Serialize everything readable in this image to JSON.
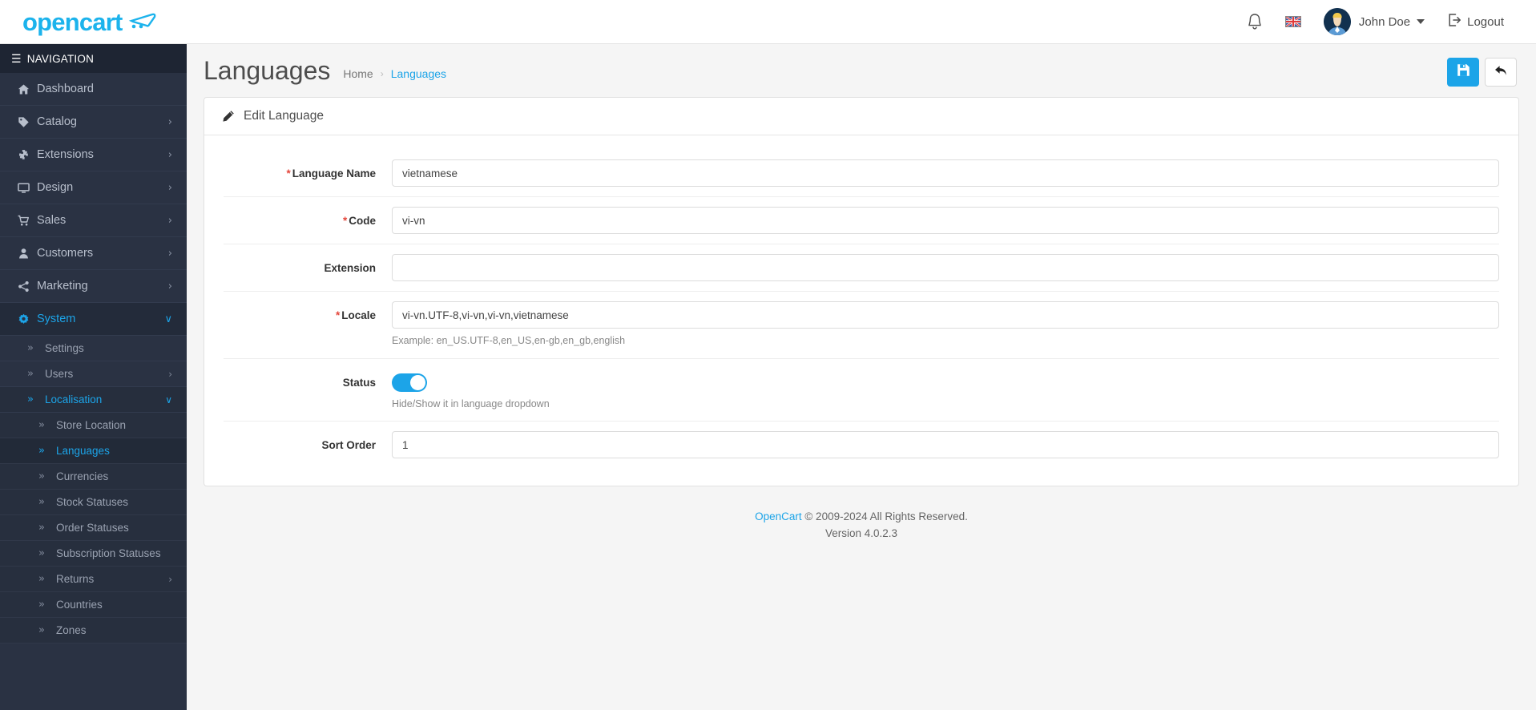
{
  "header": {
    "logo_text": "opencart",
    "bell_icon": "bell-icon",
    "flag_icon": "uk-flag-icon",
    "avatar_icon": "user-avatar",
    "user_name": "John Doe",
    "logout_label": "Logout",
    "logout_icon": "logout-icon"
  },
  "sidebar": {
    "nav_title": "NAVIGATION",
    "hamburger_icon": "hamburger-icon",
    "items": [
      {
        "label": "Dashboard",
        "icon": "home-icon",
        "arrow": "",
        "active": false
      },
      {
        "label": "Catalog",
        "icon": "tag-icon",
        "arrow": "›",
        "active": false
      },
      {
        "label": "Extensions",
        "icon": "puzzle-icon",
        "arrow": "›",
        "active": false
      },
      {
        "label": "Design",
        "icon": "monitor-icon",
        "arrow": "›",
        "active": false
      },
      {
        "label": "Sales",
        "icon": "cart-icon",
        "arrow": "›",
        "active": false
      },
      {
        "label": "Customers",
        "icon": "person-icon",
        "arrow": "›",
        "active": false
      },
      {
        "label": "Marketing",
        "icon": "share-icon",
        "arrow": "›",
        "active": false
      },
      {
        "label": "System",
        "icon": "gear-icon",
        "arrow": "∨",
        "active": true
      }
    ],
    "sub_items": [
      {
        "label": "Settings",
        "chevron": "»",
        "arrow": "",
        "active": false
      },
      {
        "label": "Users",
        "chevron": "»",
        "arrow": "›",
        "active": false
      },
      {
        "label": "Localisation",
        "chevron": "»",
        "arrow": "∨",
        "active": true
      }
    ],
    "sub3_items": [
      {
        "label": "Store Location",
        "chevron": "»",
        "arrow": "",
        "active": false
      },
      {
        "label": "Languages",
        "chevron": "»",
        "arrow": "",
        "active": true
      },
      {
        "label": "Currencies",
        "chevron": "»",
        "arrow": "",
        "active": false
      },
      {
        "label": "Stock Statuses",
        "chevron": "»",
        "arrow": "",
        "active": false
      },
      {
        "label": "Order Statuses",
        "chevron": "»",
        "arrow": "",
        "active": false
      },
      {
        "label": "Subscription Statuses",
        "chevron": "»",
        "arrow": "",
        "active": false
      },
      {
        "label": "Returns",
        "chevron": "»",
        "arrow": "›",
        "active": false
      },
      {
        "label": "Countries",
        "chevron": "»",
        "arrow": "",
        "active": false
      },
      {
        "label": "Zones",
        "chevron": "»",
        "arrow": "",
        "active": false
      }
    ]
  },
  "page": {
    "title": "Languages",
    "breadcrumb_home": "Home",
    "breadcrumb_sep": "›",
    "breadcrumb_current": "Languages",
    "save_icon": "save-icon",
    "back_icon": "back-arrow-icon"
  },
  "panel": {
    "heading": "Edit Language",
    "heading_icon": "pencil-icon"
  },
  "form": {
    "language_name": {
      "label": "Language Name",
      "required": "*",
      "value": "vietnamese",
      "placeholder": "Language Name"
    },
    "code": {
      "label": "Code",
      "required": "*",
      "value": "vi-vn",
      "placeholder": "Code"
    },
    "extension": {
      "label": "Extension",
      "value": "",
      "placeholder": ""
    },
    "locale": {
      "label": "Locale",
      "required": "*",
      "value": "vi-vn.UTF-8,vi-vn,vi-vn,vietnamese",
      "placeholder": "Locale",
      "help": "Example: en_US.UTF-8,en_US,en-gb,en_gb,english"
    },
    "status": {
      "label": "Status",
      "value": "on",
      "help": "Hide/Show it in language dropdown"
    },
    "sort_order": {
      "label": "Sort Order",
      "value": "1",
      "placeholder": "Sort Order"
    }
  },
  "footer": {
    "brand": "OpenCart",
    "copyright": " © 2009-2024 All Rights Reserved.",
    "version": "Version 4.0.2.3"
  },
  "colors": {
    "accent": "#1ca4e8",
    "sidebar_bg": "#2a3243",
    "required": "#e4473c"
  }
}
